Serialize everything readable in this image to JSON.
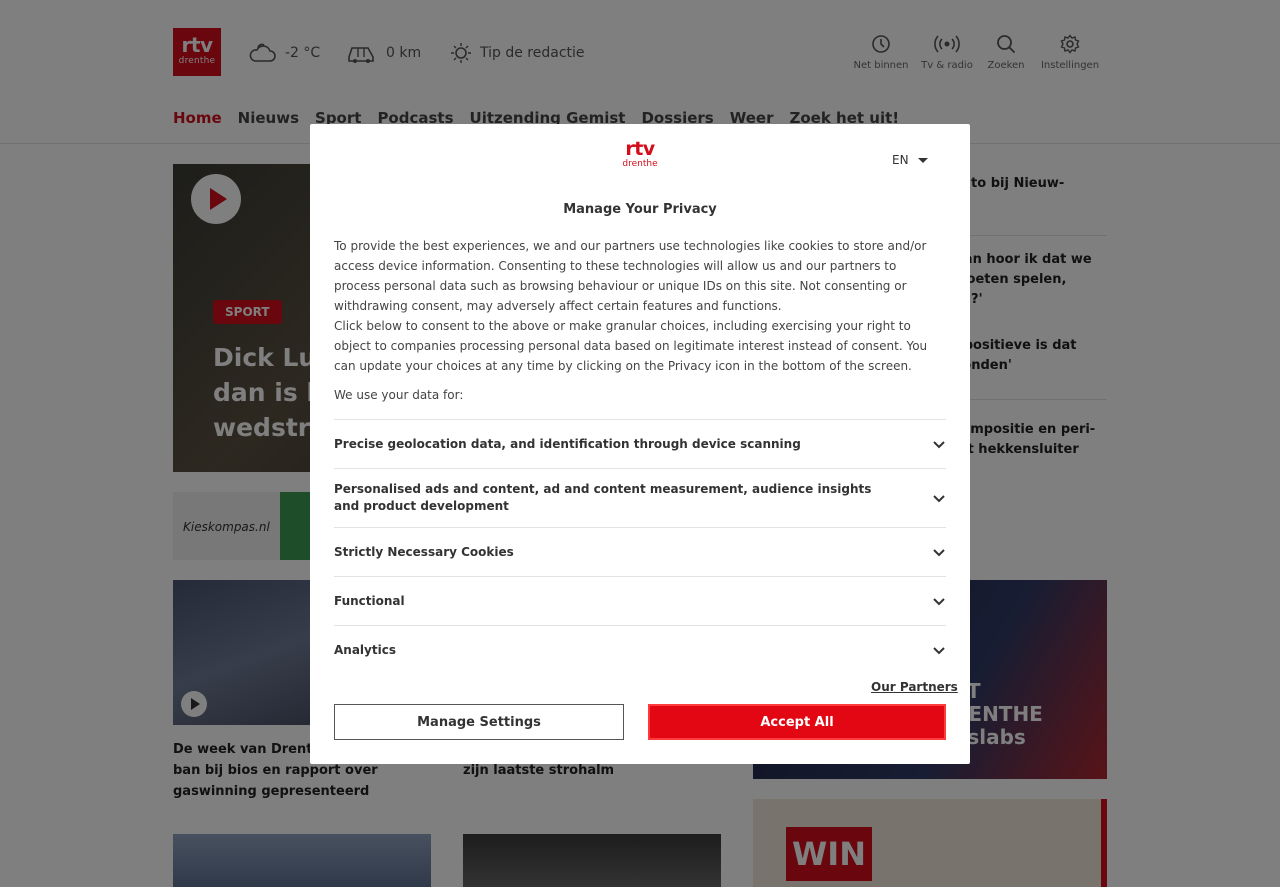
{
  "header": {
    "logo_top": "rtv",
    "logo_bottom": "drenthe",
    "weather": "-2 °C",
    "traffic": "0 km",
    "tip": "Tip de redactie",
    "tools": [
      {
        "label": "Net binnen",
        "icon": "clock-icon"
      },
      {
        "label": "Tv & radio",
        "icon": "broadcast-icon"
      },
      {
        "label": "Zoeken",
        "icon": "search-icon"
      },
      {
        "label": "Instellingen",
        "icon": "gear-icon"
      }
    ],
    "nav": [
      "Home",
      "Nieuws",
      "Sport",
      "Podcasts",
      "Uitzending Gemist",
      "Dossiers",
      "Weer",
      "Zoek het uit!"
    ],
    "active_nav": "Home"
  },
  "content": {
    "hero_tag": "SPORT",
    "hero_title": "Dick Luk\ndan is ho\nwedstrij",
    "banner_text": "Kieskompas.nl",
    "cards": [
      {
        "title": "De week van Drenthe\nban bij bios en rapport over\ngaswinning gepresenteerd"
      },
      {
        "title": "zijn laatste strohalm"
      }
    ],
    "side_items": [
      "auto bij Nieuw-",
      "Dan hoor ik dat we\nmoeten spelen,\nan?'",
      "t positieve is dat\nponden'",
      "kompositie en peri-\nijft hekkensluiter"
    ],
    "side_promo": "AT\nRENTHE\ngslabs",
    "win": "WIN"
  },
  "consent": {
    "logo_top": "rtv",
    "logo_bottom": "drenthe",
    "language": "EN",
    "title": "Manage Your Privacy",
    "paragraph1": "To provide the best experiences, we and our partners use technologies like cookies to store and/or access device information. Consenting to these technologies will allow us and our partners to process personal data such as browsing behaviour or unique IDs on this site. Not consenting or withdrawing consent, may adversely affect certain features and functions.",
    "paragraph2": "Click below to consent to the above or make granular choices, including exercising your right to object to companies processing personal data based on legitimate interest instead of consent. You can update your choices at any time by clicking on the Privacy icon in the bottom of the screen.",
    "use_label": "We use your data for:",
    "purposes": [
      "Precise geolocation data, and identification through device scanning",
      "Personalised ads and content, ad and content measurement, audience insights and product development",
      "Strictly Necessary Cookies",
      "Functional",
      "Analytics"
    ],
    "partners_link": "Our Partners",
    "manage_button": "Manage Settings",
    "accept_button": "Accept All"
  },
  "colors": {
    "brand_red": "#d40d1c",
    "accept_red": "#e30613",
    "overlay": "rgba(0,0,0,0.5)"
  }
}
